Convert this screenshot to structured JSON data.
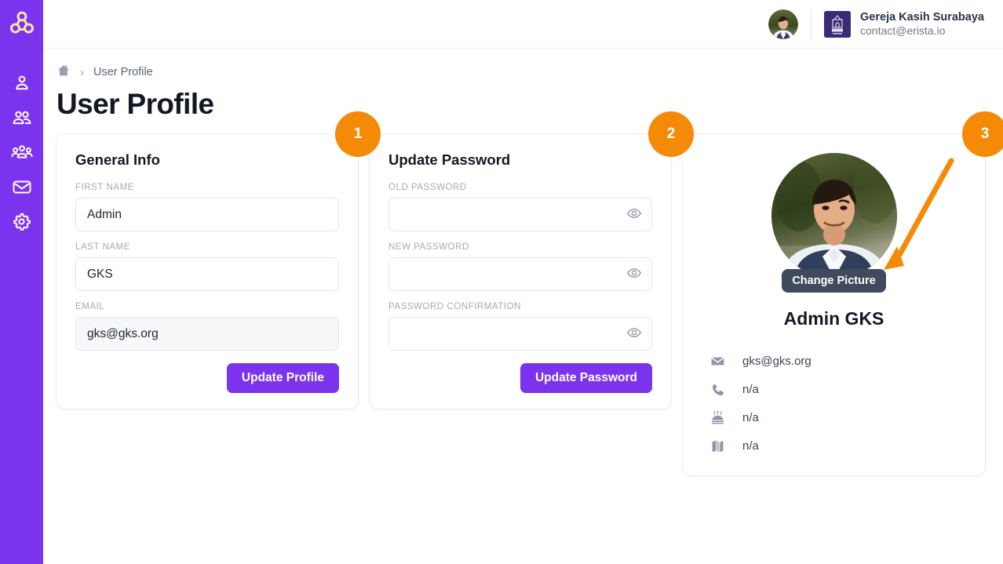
{
  "sidebar": {
    "logo_icon": "triple-circle-logo",
    "items": [
      {
        "name": "profile",
        "icon": "user-icon"
      },
      {
        "name": "couples",
        "icon": "two-users-icon"
      },
      {
        "name": "groups",
        "icon": "user-group-icon"
      },
      {
        "name": "messages",
        "icon": "envelope-icon"
      },
      {
        "name": "settings",
        "icon": "gear-icon"
      }
    ],
    "bg_color": "#7b33ee"
  },
  "topbar": {
    "user_avatar_alt": "user-avatar",
    "org_logo_alt": "gereja-kasih-surabaya-logo",
    "org_name": "Gereja Kasih Surabaya",
    "org_email": "contact@erista.io"
  },
  "breadcrumb": {
    "home_icon": "home-icon",
    "separator": "›",
    "current": "User Profile"
  },
  "page": {
    "title": "User Profile"
  },
  "general_info": {
    "title": "General Info",
    "first_name": {
      "label": "FIRST NAME",
      "value": "Admin",
      "placeholder": ""
    },
    "last_name": {
      "label": "LAST NAME",
      "value": "GKS",
      "placeholder": ""
    },
    "email": {
      "label": "EMAIL",
      "value": "gks@gks.org",
      "placeholder": ""
    },
    "submit_label": "Update Profile"
  },
  "update_password": {
    "title": "Update Password",
    "old_password": {
      "label": "OLD PASSWORD",
      "value": "",
      "placeholder": ""
    },
    "new_password": {
      "label": "NEW PASSWORD",
      "value": "",
      "placeholder": ""
    },
    "password_confirmation": {
      "label": "PASSWORD CONFIRMATION",
      "value": "",
      "placeholder": ""
    },
    "submit_label": "Update Password",
    "reveal_icon": "eye-icon"
  },
  "profile_card": {
    "avatar_alt": "profile-photo",
    "change_picture_label": "Change Picture",
    "name": "Admin GKS",
    "details": [
      {
        "icon": "envelope-icon",
        "value": "gks@gks.org"
      },
      {
        "icon": "phone-icon",
        "value": "n/a"
      },
      {
        "icon": "birthday-cake-icon",
        "value": "n/a"
      },
      {
        "icon": "open-book-icon",
        "value": "n/a"
      }
    ]
  },
  "annotations": {
    "color": "#f58a07",
    "badges": [
      {
        "label": "1"
      },
      {
        "label": "2"
      },
      {
        "label": "3"
      }
    ]
  }
}
